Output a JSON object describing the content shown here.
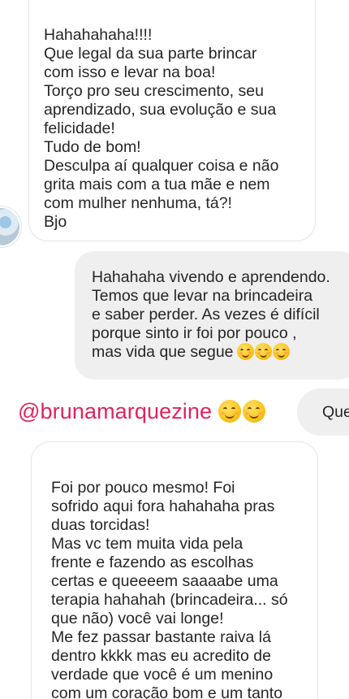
{
  "messages": {
    "received_1": {
      "text": "Hahahahaha!!!!\nQue legal da sua parte brincar\ncom isso e levar na boa!\nTorço pro seu crescimento, seu\naprendizado, sua evolução e sua\nfelicidade!\nTudo de bom!\nDesculpa aí qualquer coisa e não\ngrita mais com a tua mãe e nem\ncom mulher nenhuma, tá?!\nBjo"
    },
    "sent_1": {
      "text": "Hahahaha vivendo e aprendendo.\nTemos que levar na brincadeira\ne saber perder. As vezes é difícil\nporque sinto ir foi por pouco ,\nmas vida que segue",
      "trailing_emojis": [
        "smiling-face-icon",
        "smiling-face-icon",
        "smiling-face-icon"
      ]
    },
    "received_2": {
      "text": "Foi por pouco mesmo! Foi\nsofrido aqui fora hahahaha pras\nduas torcidas!\nMas vc tem muita vida pela\nfrente e fazendo as escolhas\ncertas e queeeem saaaabe uma\nterapia hahahah (brincadeira... só\nque não) você vai longe!\nMe fez passar bastante raiva lá\ndentro kkkk mas eu acredito de\nverdade que você é um menino\ncom um coração bom e um tanto"
    }
  },
  "overlay": {
    "mention": "@brunamarquezine",
    "mention_color": "#e0245e",
    "emojis": [
      "smiling-face-icon",
      "smiling-face-icon"
    ],
    "side_text": "Que*"
  },
  "colors": {
    "text": "#262626",
    "sent_bubble": "#efefef",
    "received_border": "#e6e6e6"
  }
}
